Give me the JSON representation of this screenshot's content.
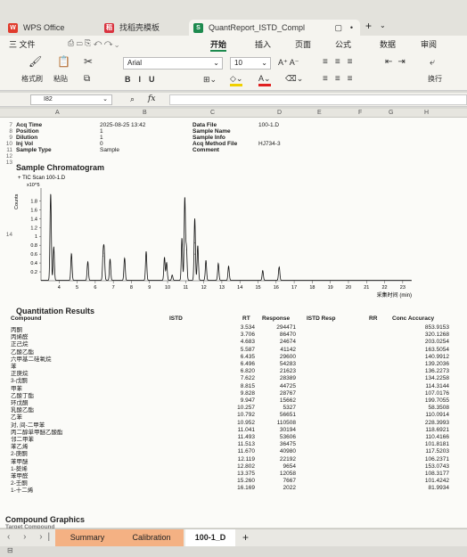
{
  "window_tabs": [
    {
      "label": "WPS Office",
      "icon": "wps-logo-icon",
      "color": "#e03b2c"
    },
    {
      "label": "找稻壳模板",
      "icon": "docer-icon",
      "color": "#d9333f"
    },
    {
      "label": "QuantReport_ISTD_Compl",
      "icon": "spreadsheet-icon",
      "color": "#1d8a4e"
    }
  ],
  "menu": {
    "file": "三 文件",
    "items": [
      "开始",
      "插入",
      "页面",
      "公式",
      "数据",
      "审阅"
    ]
  },
  "ribbon": {
    "format_painter": "格式刷",
    "paste": "粘贴",
    "font_name": "Arial",
    "font_size": "10",
    "wrap": "换行"
  },
  "formula_bar": {
    "name_box": "I82",
    "fx": "fx"
  },
  "columns": [
    "A",
    "B",
    "C",
    "D",
    "E",
    "F",
    "G",
    "H"
  ],
  "info": {
    "rows": [
      "7",
      "8",
      "9",
      "10",
      "11",
      "12",
      "13"
    ],
    "left_labels": [
      "Acq Time",
      "Position",
      "Dilution",
      "Inj Vol",
      "Sample Type"
    ],
    "left_values": [
      "2025-08-25 13:42",
      "1",
      "1",
      "0",
      "Sample"
    ],
    "right_labels": [
      "Data File",
      "Sample Name",
      "Sample Info",
      "Acq Method File",
      "Comment"
    ],
    "right_values": [
      "100-1.D",
      "",
      "",
      "HJ734-3",
      ""
    ]
  },
  "chromatogram": {
    "title": "Sample Chromatogram",
    "trace_label": "+ TIC Scan 100-1.D",
    "y_multiplier": "x10^5",
    "y_axis_label": "Counts",
    "x_axis_label": "采集时间 (min)",
    "side_row": "14"
  },
  "chart_data": {
    "type": "line",
    "title": "Sample Chromatogram",
    "xlabel": "采集时间 (min)",
    "ylabel": "Counts",
    "xlim": [
      3,
      23.5
    ],
    "ylim": [
      0,
      2.05
    ],
    "x_ticks": [
      "4",
      "5",
      "6",
      "7",
      "8",
      "9",
      "10",
      "11",
      "12",
      "13",
      "14",
      "15",
      "16",
      "17",
      "18",
      "19",
      "20",
      "21",
      "22",
      "23"
    ],
    "y_ticks": [
      "0.2",
      "0.4",
      "0.6",
      "0.8",
      "1",
      "1.2",
      "1.4",
      "1.6",
      "1.8"
    ],
    "peaks_rt": [
      3.534,
      3.706,
      4.683,
      5.587,
      6.435,
      6.496,
      6.82,
      7.622,
      8.815,
      9.828,
      9.947,
      10.257,
      10.792,
      10.952,
      11.041,
      11.493,
      11.513,
      11.67,
      12.119,
      12.802,
      13.375,
      15.26,
      16.169
    ],
    "peaks_height": [
      1.95,
      0.75,
      0.6,
      0.42,
      0.55,
      0.62,
      0.48,
      0.5,
      0.65,
      0.52,
      0.4,
      0.12,
      0.95,
      1.85,
      0.7,
      0.85,
      0.6,
      0.78,
      0.45,
      0.38,
      0.32,
      0.22,
      0.3
    ]
  },
  "quant": {
    "title": "Quantitation Results",
    "headers": {
      "compound": "Compound",
      "istd": "ISTD",
      "rt": "RT",
      "response": "Response",
      "istd_resp": "ISTD Resp",
      "rr": "RR",
      "conc": "Conc Accuracy"
    },
    "rows": [
      {
        "compound": "丙酮",
        "rt": "3.534",
        "response": "294471",
        "conc": "853.9153"
      },
      {
        "compound": "丙烯醛",
        "rt": "3.706",
        "response": "86470",
        "conc": "320.1268"
      },
      {
        "compound": "正己烷",
        "rt": "4.683",
        "response": "24674",
        "conc": "203.0254"
      },
      {
        "compound": "乙酸乙酯",
        "rt": "5.587",
        "response": "41142",
        "conc": "163.5054"
      },
      {
        "compound": "六甲基二硅氧烷",
        "rt": "6.435",
        "response": "29600",
        "conc": "140.9912"
      },
      {
        "compound": "苯",
        "rt": "6.496",
        "response": "54283",
        "conc": "139.2036"
      },
      {
        "compound": "正庚烷",
        "rt": "6.820",
        "response": "21623",
        "conc": "136.2273"
      },
      {
        "compound": "3-戊酮",
        "rt": "7.622",
        "response": "28389",
        "conc": "134.2258"
      },
      {
        "compound": "甲苯",
        "rt": "8.815",
        "response": "44725",
        "conc": "114.3144"
      },
      {
        "compound": "乙酸丁酯",
        "rt": "9.828",
        "response": "28767",
        "conc": "107.0176"
      },
      {
        "compound": "环戊酮",
        "rt": "9.947",
        "response": "15662",
        "conc": "199.7055"
      },
      {
        "compound": "乳酸乙酯",
        "rt": "10.257",
        "response": "5327",
        "conc": "58.3508"
      },
      {
        "compound": "乙苯",
        "rt": "10.792",
        "response": "56651",
        "conc": "110.0914"
      },
      {
        "compound": "对, 间-二甲苯",
        "rt": "10.952",
        "response": "110508",
        "conc": "228.3993"
      },
      {
        "compound": "丙二醇单甲醚乙酸酯",
        "rt": "11.041",
        "response": "30194",
        "conc": "118.6921"
      },
      {
        "compound": "邻二甲苯",
        "rt": "11.493",
        "response": "53606",
        "conc": "110.4166"
      },
      {
        "compound": "苯乙烯",
        "rt": "11.513",
        "response": "36475",
        "conc": "101.8181"
      },
      {
        "compound": "2-庚酮",
        "rt": "11.670",
        "response": "40980",
        "conc": "117.5203"
      },
      {
        "compound": "苯甲醚",
        "rt": "12.119",
        "response": "22192",
        "conc": "106.2371"
      },
      {
        "compound": "1-葵烯",
        "rt": "12.802",
        "response": "9654",
        "conc": "153.0743"
      },
      {
        "compound": "苯甲醛",
        "rt": "13.375",
        "response": "12058",
        "conc": "108.3177"
      },
      {
        "compound": "2-壬酮",
        "rt": "15.260",
        "response": "7667",
        "conc": "101.4242"
      },
      {
        "compound": "1-十二烯",
        "rt": "16.169",
        "response": "2022",
        "conc": "81.9934"
      }
    ]
  },
  "compound_graphics": {
    "title": "Compound Graphics",
    "sub": "Target Compound"
  },
  "sheet_tabs": [
    "Summary",
    "Calibration",
    "100-1_D"
  ],
  "tab_colors": {
    "orange": "#f4b183",
    "active": "#ffffff"
  },
  "add_tab": "+"
}
